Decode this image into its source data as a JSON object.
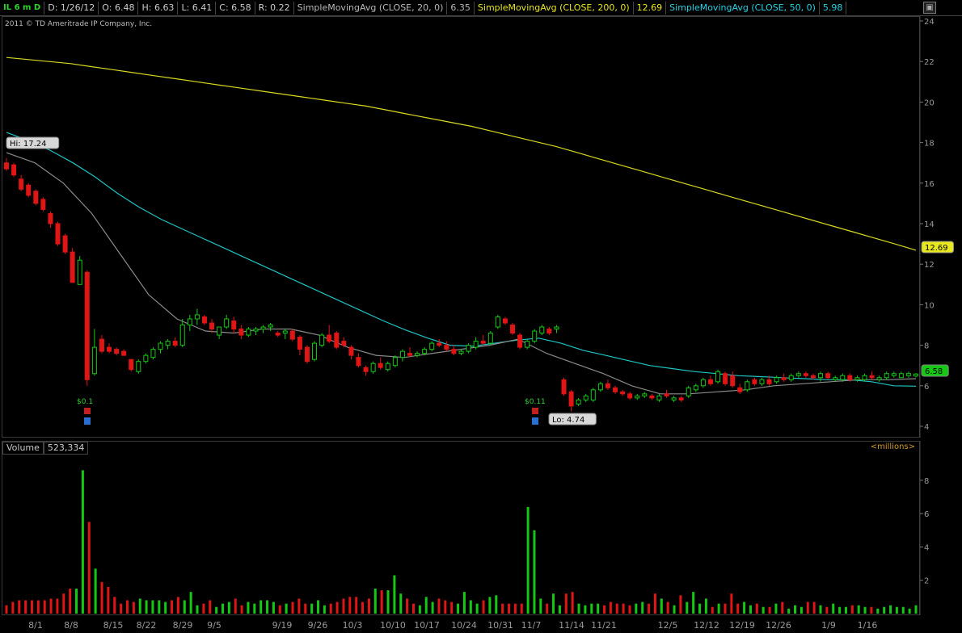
{
  "header": {
    "symbol": "IL 6 m D",
    "date": "D: 1/26/12",
    "open": "O: 6.48",
    "high": "H: 6.63",
    "low": "L: 6.41",
    "close": "C: 6.58",
    "range": "R: 0.22",
    "sma20_label": "SimpleMovingAvg (CLOSE, 20, 0)",
    "sma20_value": "6.35",
    "sma200_label": "SimpleMovingAvg (CLOSE, 200, 0)",
    "sma200_value": "12.69",
    "sma50_label": "SimpleMovingAvg (CLOSE, 50, 0)",
    "sma50_value": "5.98"
  },
  "copyright": "2011 © TD Ameritrade IP Company, Inc.",
  "volume_header": {
    "label": "Volume",
    "value": "523,334",
    "units": "<millions>"
  },
  "colors": {
    "up": "#14c814",
    "down": "#e01515",
    "sma20": "#8a8a8a",
    "sma50": "#1ec4c4",
    "sma200": "#d8d820",
    "axis": "#999999"
  },
  "chart_data": [
    {
      "type": "candlestick",
      "title": "",
      "ylim": [
        3.8,
        24.1
      ],
      "yticks": [
        4,
        6,
        8,
        10,
        12,
        14,
        16,
        18,
        20,
        22,
        24
      ],
      "x_tick_labels": [
        "8/1",
        "8/8",
        "8/15",
        "8/22",
        "8/29",
        "9/5",
        "9/19",
        "9/26",
        "10/3",
        "10/10",
        "10/17",
        "10/24",
        "10/31",
        "11/7",
        "11/14",
        "11/21",
        "12/5",
        "12/12",
        "12/19",
        "12/26",
        "1/9",
        "1/16"
      ],
      "annotations": {
        "high": "Hi: 17.24",
        "low": "Lo: 4.74",
        "price_tag_sma200": "12.69",
        "price_tag_last": "6.58",
        "dividend_1": "$0.1",
        "dividend_2": "$0.11"
      },
      "candles": [
        [
          17.0,
          17.24,
          16.6,
          16.7
        ],
        [
          16.9,
          17.0,
          16.3,
          16.4
        ],
        [
          16.2,
          16.4,
          15.6,
          15.7
        ],
        [
          15.9,
          16.0,
          15.3,
          15.4
        ],
        [
          15.6,
          15.7,
          14.9,
          15.0
        ],
        [
          15.2,
          15.3,
          14.6,
          14.7
        ],
        [
          14.5,
          14.6,
          13.8,
          14.0
        ],
        [
          14.0,
          14.1,
          12.9,
          13.0
        ],
        [
          13.4,
          13.5,
          12.5,
          12.6
        ],
        [
          12.6,
          12.8,
          11.1,
          11.1
        ],
        [
          11.0,
          12.4,
          11.0,
          12.2
        ],
        [
          11.6,
          11.7,
          6.0,
          6.3
        ],
        [
          6.6,
          8.8,
          6.5,
          7.9
        ],
        [
          8.3,
          8.5,
          7.6,
          7.7
        ],
        [
          7.9,
          8.1,
          7.6,
          7.7
        ],
        [
          7.8,
          7.9,
          7.5,
          7.6
        ],
        [
          7.7,
          7.8,
          7.5,
          7.5
        ],
        [
          7.3,
          7.3,
          6.7,
          6.8
        ],
        [
          6.7,
          7.3,
          6.6,
          7.2
        ],
        [
          7.2,
          7.6,
          7.1,
          7.5
        ],
        [
          7.4,
          7.9,
          7.3,
          7.8
        ],
        [
          7.8,
          8.2,
          7.6,
          8.1
        ],
        [
          8.0,
          8.3,
          7.8,
          8.2
        ],
        [
          8.2,
          8.4,
          7.9,
          8.0
        ],
        [
          8.0,
          9.3,
          7.9,
          9.0
        ],
        [
          9.0,
          9.5,
          8.7,
          9.3
        ],
        [
          9.3,
          9.8,
          9.0,
          9.5
        ],
        [
          9.4,
          9.5,
          9.0,
          9.1
        ],
        [
          9.1,
          9.3,
          8.6,
          8.8
        ],
        [
          8.5,
          8.9,
          8.3,
          8.9
        ],
        [
          8.9,
          9.5,
          8.8,
          9.3
        ],
        [
          9.2,
          9.4,
          8.6,
          8.8
        ],
        [
          8.8,
          9.0,
          8.3,
          8.5
        ],
        [
          8.5,
          8.9,
          8.4,
          8.8
        ],
        [
          8.7,
          8.9,
          8.5,
          8.8
        ],
        [
          8.8,
          9.0,
          8.6,
          8.9
        ],
        [
          8.9,
          9.1,
          8.7,
          9.0
        ],
        [
          8.6,
          8.7,
          8.4,
          8.5
        ],
        [
          8.6,
          8.8,
          8.3,
          8.7
        ],
        [
          8.7,
          8.8,
          8.2,
          8.3
        ],
        [
          8.4,
          8.5,
          7.5,
          7.8
        ],
        [
          7.9,
          8.0,
          7.1,
          7.2
        ],
        [
          7.3,
          8.2,
          7.2,
          8.1
        ],
        [
          8.0,
          8.6,
          7.9,
          8.5
        ],
        [
          8.5,
          9.0,
          8.1,
          8.2
        ],
        [
          8.6,
          8.7,
          7.8,
          7.9
        ],
        [
          8.2,
          8.4,
          7.9,
          8.0
        ],
        [
          7.9,
          8.0,
          7.3,
          7.5
        ],
        [
          7.4,
          7.6,
          6.9,
          7.0
        ],
        [
          6.9,
          7.0,
          6.5,
          6.7
        ],
        [
          6.7,
          7.2,
          6.6,
          7.1
        ],
        [
          7.1,
          7.4,
          6.8,
          6.9
        ],
        [
          6.8,
          7.2,
          6.7,
          7.1
        ],
        [
          7.0,
          7.5,
          6.9,
          7.4
        ],
        [
          7.4,
          7.8,
          7.2,
          7.7
        ],
        [
          7.6,
          7.9,
          7.4,
          7.5
        ],
        [
          7.5,
          7.7,
          7.4,
          7.6
        ],
        [
          7.6,
          7.9,
          7.5,
          7.8
        ],
        [
          7.8,
          8.2,
          7.7,
          8.1
        ],
        [
          8.1,
          8.3,
          7.9,
          8.0
        ],
        [
          8.0,
          8.2,
          7.7,
          7.8
        ],
        [
          7.8,
          8.0,
          7.5,
          7.6
        ],
        [
          7.6,
          7.8,
          7.5,
          7.7
        ],
        [
          7.7,
          8.1,
          7.6,
          8.0
        ],
        [
          7.9,
          8.4,
          7.8,
          8.2
        ],
        [
          8.2,
          8.5,
          8.0,
          8.1
        ],
        [
          8.1,
          8.7,
          8.0,
          8.6
        ],
        [
          8.9,
          9.5,
          8.8,
          9.4
        ],
        [
          9.3,
          9.4,
          9.0,
          9.1
        ],
        [
          9.0,
          9.1,
          8.5,
          8.6
        ],
        [
          8.5,
          8.6,
          7.8,
          7.9
        ],
        [
          7.9,
          8.3,
          7.8,
          8.2
        ],
        [
          8.2,
          8.8,
          8.1,
          8.7
        ],
        [
          8.6,
          9.0,
          8.5,
          8.9
        ],
        [
          8.8,
          8.9,
          8.5,
          8.6
        ],
        [
          8.8,
          9.0,
          8.6,
          8.9
        ],
        [
          6.3,
          6.4,
          5.5,
          5.6
        ],
        [
          5.7,
          5.8,
          4.74,
          5.0
        ],
        [
          5.1,
          5.4,
          5.0,
          5.3
        ],
        [
          5.3,
          5.6,
          5.2,
          5.5
        ],
        [
          5.3,
          5.9,
          5.2,
          5.8
        ],
        [
          5.8,
          6.2,
          5.7,
          6.1
        ],
        [
          6.1,
          6.3,
          5.8,
          5.9
        ],
        [
          5.9,
          6.0,
          5.6,
          5.7
        ],
        [
          5.7,
          5.8,
          5.5,
          5.6
        ],
        [
          5.6,
          5.7,
          5.3,
          5.4
        ],
        [
          5.4,
          5.6,
          5.3,
          5.5
        ],
        [
          5.5,
          5.7,
          5.4,
          5.6
        ],
        [
          5.5,
          5.6,
          5.3,
          5.4
        ],
        [
          5.3,
          5.6,
          5.2,
          5.5
        ],
        [
          5.6,
          5.8,
          5.4,
          5.5
        ],
        [
          5.3,
          5.5,
          5.2,
          5.4
        ],
        [
          5.4,
          5.5,
          5.2,
          5.3
        ],
        [
          5.5,
          6.0,
          5.4,
          5.9
        ],
        [
          5.8,
          6.1,
          5.7,
          6.0
        ],
        [
          6.0,
          6.4,
          5.9,
          6.3
        ],
        [
          6.3,
          6.5,
          6.0,
          6.1
        ],
        [
          6.2,
          6.8,
          6.1,
          6.7
        ],
        [
          6.6,
          6.7,
          6.0,
          6.1
        ],
        [
          6.5,
          6.7,
          5.9,
          6.0
        ],
        [
          5.9,
          6.1,
          5.6,
          5.7
        ],
        [
          5.8,
          6.3,
          5.7,
          6.2
        ],
        [
          6.3,
          6.4,
          6.0,
          6.1
        ],
        [
          6.1,
          6.4,
          6.0,
          6.3
        ],
        [
          6.3,
          6.5,
          6.0,
          6.1
        ],
        [
          6.2,
          6.5,
          6.1,
          6.4
        ],
        [
          6.4,
          6.6,
          6.2,
          6.3
        ],
        [
          6.3,
          6.6,
          6.2,
          6.5
        ],
        [
          6.5,
          6.7,
          6.4,
          6.6
        ],
        [
          6.6,
          6.7,
          6.4,
          6.5
        ],
        [
          6.5,
          6.6,
          6.3,
          6.4
        ],
        [
          6.4,
          6.7,
          6.2,
          6.6
        ],
        [
          6.6,
          6.7,
          6.3,
          6.4
        ],
        [
          6.3,
          6.5,
          6.2,
          6.4
        ],
        [
          6.3,
          6.6,
          6.2,
          6.5
        ],
        [
          6.5,
          6.6,
          6.2,
          6.3
        ],
        [
          6.3,
          6.5,
          6.2,
          6.4
        ],
        [
          6.3,
          6.6,
          6.2,
          6.5
        ],
        [
          6.5,
          6.7,
          6.3,
          6.4
        ],
        [
          6.3,
          6.5,
          6.2,
          6.4
        ],
        [
          6.4,
          6.7,
          6.3,
          6.6
        ],
        [
          6.5,
          6.7,
          6.4,
          6.6
        ],
        [
          6.4,
          6.7,
          6.4,
          6.6
        ],
        [
          6.5,
          6.7,
          6.4,
          6.6
        ],
        [
          6.48,
          6.63,
          6.41,
          6.58
        ]
      ],
      "series": [
        {
          "name": "SimpleMovingAvg (CLOSE, 200, 0)",
          "values": [
            22.2,
            22.1,
            22.0,
            21.9,
            21.75,
            21.6,
            21.45,
            21.3,
            21.15,
            21.0,
            20.85,
            20.7,
            20.55,
            20.4,
            20.25,
            20.1,
            19.95,
            19.8,
            19.6,
            19.4,
            19.2,
            19.0,
            18.8,
            18.55,
            18.3,
            18.05,
            17.8,
            17.5,
            17.2,
            16.9,
            16.6,
            16.3,
            16.0,
            15.7,
            15.4,
            15.1,
            14.8,
            14.5,
            14.2,
            13.9,
            13.6,
            13.3,
            13.0,
            12.69
          ]
        },
        {
          "name": "SimpleMovingAvg (CLOSE, 50, 0)",
          "values": [
            18.5,
            18.1,
            17.6,
            17.0,
            16.3,
            15.5,
            14.8,
            14.2,
            13.7,
            13.2,
            12.7,
            12.2,
            11.7,
            11.2,
            10.7,
            10.2,
            9.7,
            9.2,
            8.75,
            8.35,
            8.0,
            7.95,
            8.1,
            8.25,
            8.35,
            8.1,
            7.75,
            7.5,
            7.25,
            7.0,
            6.85,
            6.7,
            6.6,
            6.5,
            6.45,
            6.4,
            6.35,
            6.3,
            6.3,
            6.2,
            6.0,
            5.98
          ]
        },
        {
          "name": "SimpleMovingAvg (CLOSE, 20, 0)",
          "values": [
            17.5,
            17.0,
            16.0,
            14.5,
            12.5,
            10.5,
            9.3,
            8.7,
            8.6,
            8.8,
            8.8,
            8.5,
            7.9,
            7.5,
            7.4,
            7.6,
            7.8,
            8.0,
            8.3,
            7.6,
            7.1,
            6.6,
            6.0,
            5.6,
            5.6,
            5.7,
            5.8,
            6.0,
            6.1,
            6.2,
            6.3,
            6.3,
            6.35
          ]
        }
      ]
    },
    {
      "type": "bar",
      "title": "Volume",
      "units": "millions",
      "ylim": [
        0,
        9.3
      ],
      "yticks": [
        2,
        4,
        6,
        8
      ],
      "values": [
        0.5,
        0.7,
        0.8,
        0.8,
        0.8,
        0.8,
        0.8,
        0.9,
        0.9,
        1.2,
        1.5,
        1.5,
        8.6,
        5.5,
        2.7,
        1.9,
        1.6,
        1.0,
        0.6,
        0.8,
        0.7,
        0.9,
        0.8,
        0.8,
        0.8,
        0.7,
        0.8,
        1.0,
        0.8,
        1.3,
        0.5,
        0.6,
        0.8,
        0.4,
        0.6,
        0.7,
        0.9,
        0.5,
        0.7,
        0.6,
        0.8,
        0.8,
        0.7,
        0.5,
        0.6,
        0.7,
        0.9,
        0.6,
        0.6,
        0.8,
        0.5,
        0.6,
        0.7,
        0.9,
        1.0,
        1.0,
        0.7,
        0.9,
        1.5,
        1.4,
        1.4,
        2.3,
        1.2,
        0.9,
        0.6,
        0.5,
        1.0,
        0.7,
        0.9,
        0.8,
        0.7,
        0.6,
        1.3,
        0.8,
        0.6,
        0.8,
        1.0,
        1.1,
        0.6,
        0.6,
        0.6,
        0.6,
        6.4,
        5.0,
        0.9,
        0.6,
        1.2,
        0.5,
        1.2,
        1.3,
        0.6,
        0.5,
        0.6,
        0.6,
        0.5,
        0.7,
        0.6,
        0.6,
        0.5,
        0.6,
        0.7,
        0.6,
        1.2,
        0.9,
        0.7,
        0.5,
        1.1,
        0.7,
        1.3,
        0.6,
        0.9,
        0.4,
        0.6,
        0.6,
        1.2,
        0.6,
        0.7,
        0.5,
        0.6,
        0.4,
        0.4,
        0.6,
        0.7,
        0.3,
        0.5,
        0.4,
        0.7,
        0.7,
        0.5,
        0.4,
        0.6,
        0.4,
        0.4,
        0.5,
        0.5,
        0.4,
        0.4,
        0.3,
        0.4,
        0.5,
        0.4,
        0.4,
        0.3,
        0.5
      ],
      "colors_up": "mirrors price candle direction"
    }
  ]
}
